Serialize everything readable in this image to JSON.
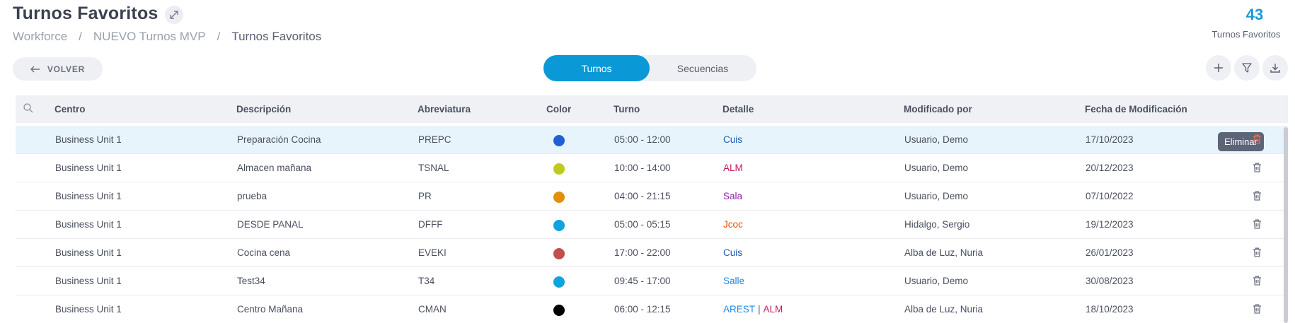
{
  "page": {
    "title": "Turnos Favoritos",
    "breadcrumb": [
      "Workforce",
      "NUEVO Turnos MVP",
      "Turnos Favoritos"
    ],
    "counter": {
      "value": "43",
      "label": "Turnos Favoritos"
    },
    "back_label": "VOLVER",
    "tabs": [
      {
        "label": "Turnos",
        "active": true
      },
      {
        "label": "Secuencias",
        "active": false
      }
    ]
  },
  "table": {
    "columns": [
      "Centro",
      "Descripción",
      "Abreviatura",
      "Color",
      "Turno",
      "Detalle",
      "Modificado por",
      "Fecha de Modificación"
    ],
    "tooltip": "Eliminar",
    "rows": [
      {
        "centro": "Business Unit 1",
        "descripcion": "Preparación Cocina",
        "abreviatura": "PREPC",
        "color": "#1f5fd9",
        "turno": "05:00 - 12:00",
        "detalle": [
          {
            "text": "Cuis",
            "color": "#1f5fb0"
          }
        ],
        "modificado": "Usuario, Demo",
        "fecha": "17/10/2023"
      },
      {
        "centro": "Business Unit 1",
        "descripcion": "Almacen mañana",
        "abreviatura": "TSNAL",
        "color": "#bccb1c",
        "turno": "10:00 - 14:00",
        "detalle": [
          {
            "text": "ALM",
            "color": "#c2185b"
          }
        ],
        "modificado": "Usuario, Demo",
        "fecha": "20/12/2023"
      },
      {
        "centro": "Business Unit 1",
        "descripcion": "prueba",
        "abreviatura": "PR",
        "color": "#e0900e",
        "turno": "04:00 - 21:15",
        "detalle": [
          {
            "text": "Sala",
            "color": "#8e24aa"
          }
        ],
        "modificado": "Usuario, Demo",
        "fecha": "07/10/2022"
      },
      {
        "centro": "Business Unit 1",
        "descripcion": "DESDE PANAL",
        "abreviatura": "DFFF",
        "color": "#0ea4de",
        "turno": "05:00 - 05:15",
        "detalle": [
          {
            "text": "Jcoc",
            "color": "#e65100"
          }
        ],
        "modificado": "Hidalgo, Sergio",
        "fecha": "19/12/2023"
      },
      {
        "centro": "Business Unit 1",
        "descripcion": "Cocina cena",
        "abreviatura": "EVEKI",
        "color": "#c0504d",
        "turno": "17:00 - 22:00",
        "detalle": [
          {
            "text": "Cuis",
            "color": "#1f5fb0"
          }
        ],
        "modificado": "Alba de Luz, Nuria",
        "fecha": "26/01/2023"
      },
      {
        "centro": "Business Unit 1",
        "descripcion": "Test34",
        "abreviatura": "T34",
        "color": "#0ea4de",
        "turno": "09:45 - 17:00",
        "detalle": [
          {
            "text": "Salle",
            "color": "#1e88e5"
          }
        ],
        "modificado": "Usuario, Demo",
        "fecha": "30/08/2023"
      },
      {
        "centro": "Business Unit 1",
        "descripcion": "Centro Mañana",
        "abreviatura": "CMAN",
        "color": "#000000",
        "turno": "06:00 - 12:15",
        "detalle": [
          {
            "text": "AREST",
            "color": "#1e88e5"
          },
          {
            "text": "ALM",
            "color": "#c2185b"
          }
        ],
        "modificado": "Alba de Luz, Nuria",
        "fecha": "18/10/2023"
      }
    ]
  }
}
